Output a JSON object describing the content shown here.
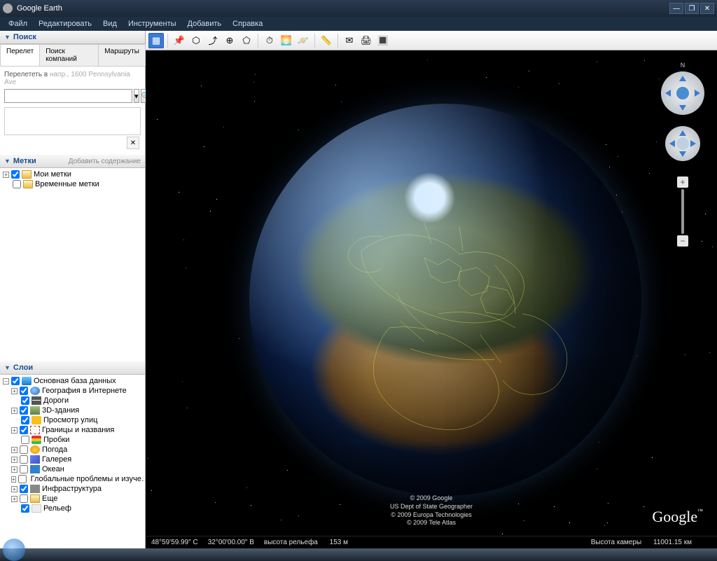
{
  "app": {
    "title": "Google Earth"
  },
  "menu": [
    "Файл",
    "Редактировать",
    "Вид",
    "Инструменты",
    "Добавить",
    "Справка"
  ],
  "win_controls": {
    "min": "—",
    "max": "❐",
    "close": "✕"
  },
  "sidebar": {
    "search": {
      "title": "Поиск",
      "tabs": [
        "Перелет",
        "Поиск компаний",
        "Маршруты"
      ],
      "hint_prefix": "Перелететь в",
      "hint_example": "напр., 1600 Pennsylvania Ave",
      "close_btn": "✕"
    },
    "places": {
      "title": "Метки",
      "add_label": "Добавить содержание",
      "items": [
        {
          "label": "Мои метки",
          "icon": "folder-ic",
          "checked": true,
          "expandable": true
        },
        {
          "label": "Временные метки",
          "icon": "folder-ic",
          "checked": false,
          "expandable": false
        }
      ]
    },
    "layers": {
      "title": "Слои",
      "root": {
        "label": "Основная база данных",
        "icon": "db-ic",
        "checked": true
      },
      "items": [
        {
          "label": "География в Интернете",
          "icon": "globe-ic",
          "checked": true,
          "expandable": true
        },
        {
          "label": "Дороги",
          "icon": "road-ic",
          "checked": true,
          "expandable": false
        },
        {
          "label": "3D-здания",
          "icon": "bldg-ic",
          "checked": true,
          "expandable": true
        },
        {
          "label": "Просмотр улиц",
          "icon": "man-ic",
          "checked": true,
          "expandable": false
        },
        {
          "label": "Границы и названия",
          "icon": "border-ic",
          "checked": true,
          "expandable": true
        },
        {
          "label": "Пробки",
          "icon": "traffic-ic",
          "checked": false,
          "expandable": false
        },
        {
          "label": "Погода",
          "icon": "sun-ic",
          "checked": false,
          "expandable": true
        },
        {
          "label": "Галерея",
          "icon": "gallery-ic",
          "checked": false,
          "expandable": true
        },
        {
          "label": "Океан",
          "icon": "ocean-ic",
          "checked": false,
          "expandable": true
        },
        {
          "label": "Глобальные проблемы и изуче…",
          "icon": "globe-ic",
          "checked": false,
          "expandable": true
        },
        {
          "label": "Инфраструктура",
          "icon": "infra-ic",
          "checked": true,
          "expandable": true
        },
        {
          "label": "Еще",
          "icon": "folder-ic",
          "checked": false,
          "expandable": true
        },
        {
          "label": "Рельеф",
          "icon": "blank-ic",
          "checked": true,
          "expandable": false
        }
      ]
    }
  },
  "toolbar_glyphs": [
    "▦",
    "📌",
    "⬡",
    "⤴",
    "⊕",
    "⬠",
    "⏱",
    "🌅",
    "🪐",
    "📏",
    "✉",
    "🖨",
    "🔳"
  ],
  "attribution": [
    "© 2009 Google",
    "US Dept of State Geographer",
    "© 2009 Europa Technologies",
    "© 2009 Tele Atlas"
  ],
  "logo": "Google",
  "logo_tm": "™",
  "status": {
    "lat": "48°59'59.99\" С",
    "lon": "32°00'00.00\" В",
    "elev_label": "высота рельефа",
    "elev_value": "153 м",
    "eye_label": "Высота камеры",
    "eye_value": "11001.15 км"
  },
  "compass_n": "N"
}
